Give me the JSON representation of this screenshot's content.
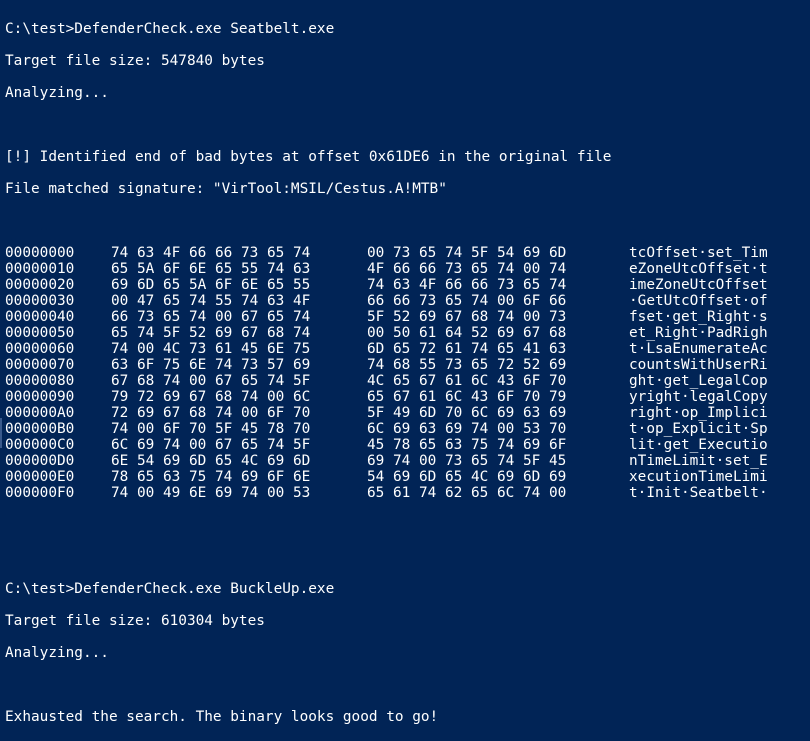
{
  "session1": {
    "command": "C:\\test>DefenderCheck.exe Seatbelt.exe",
    "target_size": "Target file size: 547840 bytes",
    "analyzing": "Analyzing...",
    "identified": "[!] Identified end of bad bytes at offset 0x61DE6 in the original file",
    "signature": "File matched signature: \"VirTool:MSIL/Cestus.A!MTB\""
  },
  "hexdump": [
    {
      "offset": "00000000",
      "hex1": "74 63 4F 66 66 73 65 74",
      "hex2": "00 73 65 74 5F 54 69 6D",
      "ascii": "tcOffset·set_Tim"
    },
    {
      "offset": "00000010",
      "hex1": "65 5A 6F 6E 65 55 74 63",
      "hex2": "4F 66 66 73 65 74 00 74",
      "ascii": "eZoneUtcOffset·t"
    },
    {
      "offset": "00000020",
      "hex1": "69 6D 65 5A 6F 6E 65 55",
      "hex2": "74 63 4F 66 66 73 65 74",
      "ascii": "imeZoneUtcOffset"
    },
    {
      "offset": "00000030",
      "hex1": "00 47 65 74 55 74 63 4F",
      "hex2": "66 66 73 65 74 00 6F 66",
      "ascii": "·GetUtcOffset·of"
    },
    {
      "offset": "00000040",
      "hex1": "66 73 65 74 00 67 65 74",
      "hex2": "5F 52 69 67 68 74 00 73",
      "ascii": "fset·get_Right·s"
    },
    {
      "offset": "00000050",
      "hex1": "65 74 5F 52 69 67 68 74",
      "hex2": "00 50 61 64 52 69 67 68",
      "ascii": "et_Right·PadRigh"
    },
    {
      "offset": "00000060",
      "hex1": "74 00 4C 73 61 45 6E 75",
      "hex2": "6D 65 72 61 74 65 41 63",
      "ascii": "t·LsaEnumerateAc"
    },
    {
      "offset": "00000070",
      "hex1": "63 6F 75 6E 74 73 57 69",
      "hex2": "74 68 55 73 65 72 52 69",
      "ascii": "countsWithUserRi"
    },
    {
      "offset": "00000080",
      "hex1": "67 68 74 00 67 65 74 5F",
      "hex2": "4C 65 67 61 6C 43 6F 70",
      "ascii": "ght·get_LegalCop"
    },
    {
      "offset": "00000090",
      "hex1": "79 72 69 67 68 74 00 6C",
      "hex2": "65 67 61 6C 43 6F 70 79",
      "ascii": "yright·legalCopy"
    },
    {
      "offset": "000000A0",
      "hex1": "72 69 67 68 74 00 6F 70",
      "hex2": "5F 49 6D 70 6C 69 63 69",
      "ascii": "right·op_Implici"
    },
    {
      "offset": "000000B0",
      "hex1": "74 00 6F 70 5F 45 78 70",
      "hex2": "6C 69 63 69 74 00 53 70",
      "ascii": "t·op_Explicit·Sp"
    },
    {
      "offset": "000000C0",
      "hex1": "6C 69 74 00 67 65 74 5F",
      "hex2": "45 78 65 63 75 74 69 6F",
      "ascii": "lit·get_Executio"
    },
    {
      "offset": "000000D0",
      "hex1": "6E 54 69 6D 65 4C 69 6D",
      "hex2": "69 74 00 73 65 74 5F 45",
      "ascii": "nTimeLimit·set_E"
    },
    {
      "offset": "000000E0",
      "hex1": "78 65 63 75 74 69 6F 6E",
      "hex2": "54 69 6D 65 4C 69 6D 69",
      "ascii": "xecutionTimeLimi"
    },
    {
      "offset": "000000F0",
      "hex1": "74 00 49 6E 69 74 00 53",
      "hex2": "65 61 74 62 65 6C 74 00",
      "ascii": "t·Init·Seatbelt·"
    }
  ],
  "session2": {
    "command": "C:\\test>DefenderCheck.exe BuckleUp.exe",
    "target_size": "Target file size: 610304 bytes",
    "analyzing": "Analyzing...",
    "result": "Exhausted the search. The binary looks good to go!"
  },
  "colors": {
    "background": "#012456",
    "text": "#ffffff"
  }
}
